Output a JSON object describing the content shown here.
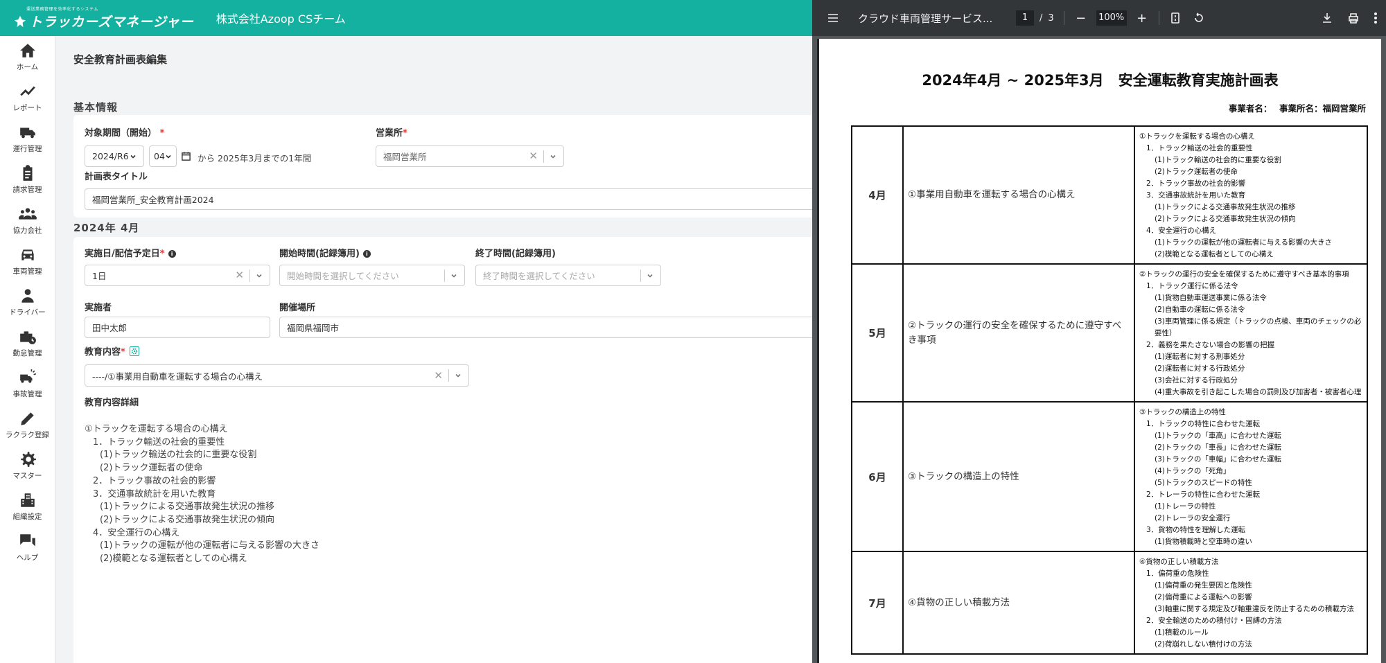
{
  "header": {
    "logo_tagline": "運送業務管理を効率化するシステム",
    "logo_name": "トラッカーズマネージャー",
    "company": "株式会社Azoop CSチーム"
  },
  "sidebar": {
    "items": [
      {
        "label": "ホーム",
        "icon": "home-icon"
      },
      {
        "label": "レポート",
        "icon": "chart-icon"
      },
      {
        "label": "運行管理",
        "icon": "truck-icon"
      },
      {
        "label": "請求管理",
        "icon": "clipboard-icon"
      },
      {
        "label": "協力会社",
        "icon": "group-icon"
      },
      {
        "label": "車両管理",
        "icon": "car-icon"
      },
      {
        "label": "ドライバー",
        "icon": "person-icon"
      },
      {
        "label": "勤怠管理",
        "icon": "briefcase-clock-icon"
      },
      {
        "label": "事故管理",
        "icon": "accident-icon"
      },
      {
        "label": "ラクラク登録",
        "icon": "pencil-icon"
      },
      {
        "label": "マスター",
        "icon": "gear-icon"
      },
      {
        "label": "組織設定",
        "icon": "building-icon"
      },
      {
        "label": "ヘルプ",
        "icon": "chat-icon"
      }
    ]
  },
  "main": {
    "page_title": "安全教育計画表編集",
    "basic": {
      "section_title": "基本情報",
      "period_label": "対象期間（開始）",
      "period_year": "2024/R6",
      "period_month": "04",
      "range_text": "から 2025年3月までの1年間",
      "office_label": "営業所",
      "office_value": "福岡営業所",
      "plan_title_label": "計画表タイトル",
      "plan_title_value": "福岡営業所_安全教育計画2024"
    },
    "month": {
      "section_title": "2024年 4月",
      "date_label": "実施日/配信予定日",
      "date_value": "1日",
      "start_label": "開始時間(記録簿用)",
      "start_placeholder": "開始時間を選択してください",
      "end_label": "終了時間(記録簿用)",
      "end_placeholder": "終了時間を選択してください",
      "instructor_label": "実施者",
      "instructor_value": "田中太郎",
      "venue_label": "開催場所",
      "venue_value": "福岡県福岡市",
      "content_label": "教育内容",
      "content_value": "----/①事業用自動車を運転する場合の心構え",
      "detail_label": "教育内容詳細",
      "detail_lines": [
        "①トラックを運転する場合の心構え",
        "1．トラック輸送の社会的重要性",
        "(1)トラック輸送の社会的に重要な役割",
        "(2)トラック運転者の使命",
        "2．トラック事故の社会的影響",
        "3．交通事故統計を用いた教育",
        "(1)トラックによる交通事故発生状況の推移",
        "(2)トラックによる交通事故発生状況の傾向",
        "4．安全運行の心構え",
        "(1)トラックの運転が他の運転者に与える影響の大きさ",
        "(2)模範となる運転者としての心構え"
      ],
      "detail_indent": [
        0,
        1,
        2,
        2,
        1,
        1,
        2,
        2,
        1,
        2,
        2
      ]
    }
  },
  "viewer": {
    "title": "クラウド車両管理サービス...",
    "page_current": "1",
    "page_sep": "/",
    "page_total": "3",
    "zoom": "100%"
  },
  "pdf": {
    "title": "2024年4月 ~ 2025年3月　安全運転教育実施計画表",
    "subtitle": "事業者名：　 事業所名：福岡営業所",
    "rows": [
      {
        "month": "4月",
        "topic": "①事業用自動車を運転する場合の心構え",
        "details": [
          {
            "t": "①トラックを運転する場合の心構え",
            "l": 0
          },
          {
            "t": "1．トラック輸送の社会的重要性",
            "l": 1
          },
          {
            "t": "(1)トラック輸送の社会的に重要な役割",
            "l": 2
          },
          {
            "t": "(2)トラック運転者の使命",
            "l": 2
          },
          {
            "t": "2．トラック事故の社会的影響",
            "l": 1
          },
          {
            "t": "3．交通事故統計を用いた教育",
            "l": 1
          },
          {
            "t": "(1)トラックによる交通事故発生状況の推移",
            "l": 2
          },
          {
            "t": "(2)トラックによる交通事故発生状況の傾向",
            "l": 2
          },
          {
            "t": "4．安全運行の心構え",
            "l": 1
          },
          {
            "t": "(1)トラックの運転が他の運転者に与える影響の大きさ",
            "l": 2
          },
          {
            "t": "(2)模範となる運転者としての心構え",
            "l": 2
          }
        ]
      },
      {
        "month": "5月",
        "topic": "②トラックの運行の安全を確保するために遵守すべき事項",
        "details": [
          {
            "t": "②トラックの運行の安全を確保するために遵守すべき基本的事項",
            "l": 0
          },
          {
            "t": "1．トラック運行に係る法令",
            "l": 1
          },
          {
            "t": "(1)貨物自動車運送事業に係る法令",
            "l": 2
          },
          {
            "t": "(2)自動車の運転に係る法令",
            "l": 2
          },
          {
            "t": "(3)車両管理に係る規定（トラックの点検、車両のチェックの必要性）",
            "l": 2
          },
          {
            "t": "2．義務を果たさない場合の影響の把握",
            "l": 1
          },
          {
            "t": "(1)運転者に対する刑事処分",
            "l": 2
          },
          {
            "t": "(2)運転者に対する行政処分",
            "l": 2
          },
          {
            "t": "(3)会社に対する行政処分",
            "l": 2
          },
          {
            "t": "(4)重大事故を引き起こした場合の罰則及び加害者・被害者心理",
            "l": 2
          }
        ]
      },
      {
        "month": "6月",
        "topic": "③トラックの構造上の特性",
        "details": [
          {
            "t": "③トラックの構造上の特性",
            "l": 0
          },
          {
            "t": "1．トラックの特性に合わせた運転",
            "l": 1
          },
          {
            "t": "(1)トラックの「車高」に合わせた運転",
            "l": 2
          },
          {
            "t": "(2)トラックの「車長」に合わせた運転",
            "l": 2
          },
          {
            "t": "(3)トラックの「車幅」に合わせた運転",
            "l": 2
          },
          {
            "t": "(4)トラックの「死角」",
            "l": 2
          },
          {
            "t": "(5)トラックのスピードの特性",
            "l": 2
          },
          {
            "t": "2．トレーラの特性に合わせた運転",
            "l": 1
          },
          {
            "t": "(1)トレーラの特性",
            "l": 2
          },
          {
            "t": "(2)トレーラの安全運行",
            "l": 2
          },
          {
            "t": "3．貨物の特性を理解した運転",
            "l": 1
          },
          {
            "t": "(1)貨物積載時と空車時の違い",
            "l": 2
          }
        ]
      },
      {
        "month": "7月",
        "topic": "④貨物の正しい積載方法",
        "details": [
          {
            "t": "④貨物の正しい積載方法",
            "l": 0
          },
          {
            "t": "1．偏荷重の危険性",
            "l": 1
          },
          {
            "t": "(1)偏荷重の発生要因と危険性",
            "l": 2
          },
          {
            "t": "(2)偏荷重による運転への影響",
            "l": 2
          },
          {
            "t": "(3)軸重に関する規定及び軸重違反を防止するための積載方法",
            "l": 2
          },
          {
            "t": "2．安全輸送のための積付け・固縛の方法",
            "l": 1
          },
          {
            "t": "(1)積載のルール",
            "l": 2
          },
          {
            "t": "(2)荷崩れしない積付けの方法",
            "l": 2
          }
        ]
      }
    ]
  }
}
